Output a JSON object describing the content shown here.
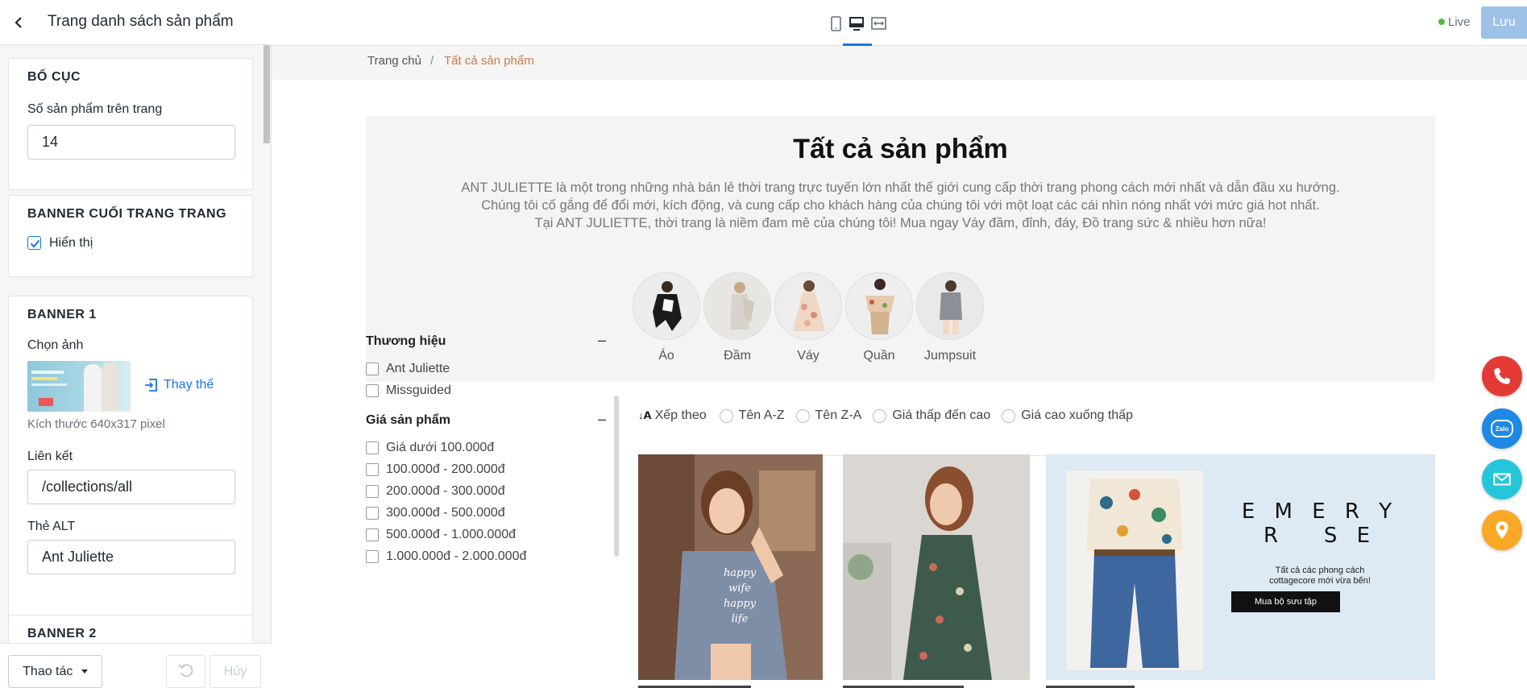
{
  "editor": {
    "title": "Trang danh sách sản phẩm",
    "sections": {
      "layout": {
        "title": "BỐ CỤC",
        "products_per_page_label": "Số sản phẩm trên trang",
        "products_per_page_value": "14"
      },
      "bottom_banner": {
        "title": "BANNER CUỐI TRANG TRANG",
        "show_label": "Hiển thị",
        "show_checked": true
      },
      "banner1": {
        "title": "BANNER 1",
        "image_label": "Chọn ảnh",
        "replace_label": "Thay thế",
        "size_hint": "Kích thước 640x317 pixel",
        "link_label": "Liên kết",
        "link_value": "/collections/all",
        "alt_label": "Thẻ ALT",
        "alt_value": "Ant Juliette"
      },
      "banner2": {
        "title": "BANNER 2"
      }
    },
    "footer": {
      "actions_label": "Thao tác",
      "cancel_label": "Hủy"
    }
  },
  "topbar": {
    "devices": [
      "mobile-icon",
      "desktop-icon",
      "fullwidth-icon"
    ],
    "active_device": "desktop-icon",
    "live_label": "Live",
    "save_label": "Lưu",
    "accent_color": "#1a73e8",
    "live_color": "#50b83c"
  },
  "preview": {
    "breadcrumb": {
      "home": "Trang chủ",
      "separator": "/",
      "current": "Tất cả sản phẩm"
    },
    "hero": {
      "title": "Tất cả sản phẩm",
      "lines": [
        "ANT JULIETTE là một trong những nhà bán lẻ thời trang trực tuyến lớn nhất thế giới cung cấp thời trang phong cách mới nhất và dẫn đầu xu hướng.",
        "Chúng tôi cố gắng để đổi mới, kích động, và cung cấp cho khách hàng của chúng tôi với một loạt các cái nhìn nóng nhất với mức giá hot nhất.",
        "Tại ANT JULIETTE, thời trang là niềm đam mê của chúng tôi! Mua ngay Váy đầm, đỉnh, đáy, Đồ trang sức & nhiều hơn nữa!"
      ],
      "categories": [
        "Áo",
        "Đầm",
        "Váy",
        "Quần",
        "Jumpsuit"
      ]
    },
    "filters": {
      "brand": {
        "title": "Thương hiệu",
        "collapse": "–",
        "options": [
          "Ant Juliette",
          "Missguided"
        ]
      },
      "price": {
        "title": "Giá sản phẩm",
        "collapse": "–",
        "options": [
          "Giá dưới 100.000đ",
          "100.000đ - 200.000đ",
          "200.000đ - 300.000đ",
          "300.000đ - 500.000đ",
          "500.000đ - 1.000.000đ",
          "1.000.000đ - 2.000.000đ"
        ]
      }
    },
    "sort": {
      "label": "Xếp theo",
      "options": [
        "Tên A-Z",
        "Tên Z-A",
        "Giá thấp đến cao",
        "Giá cao xuống thấp"
      ]
    },
    "promo_banner": {
      "brand_line1": "E M E R Y",
      "brand_line2": "R   S E",
      "tagline": "Tất cả các phong cách cottagecore mới vừa bến!",
      "cta": "Mua bộ sưu tập"
    },
    "products": [
      {
        "shirt_text": "happy wife happy life"
      }
    ]
  },
  "floating": [
    "phone-icon",
    "zalo-icon",
    "mail-icon",
    "location-icon"
  ],
  "floating_labels": {
    "zalo": "Zalo"
  },
  "floating_colors": {
    "phone": "#e53935",
    "zalo": "#1e88e5",
    "mail": "#26c6da",
    "location": "#f9a825"
  }
}
